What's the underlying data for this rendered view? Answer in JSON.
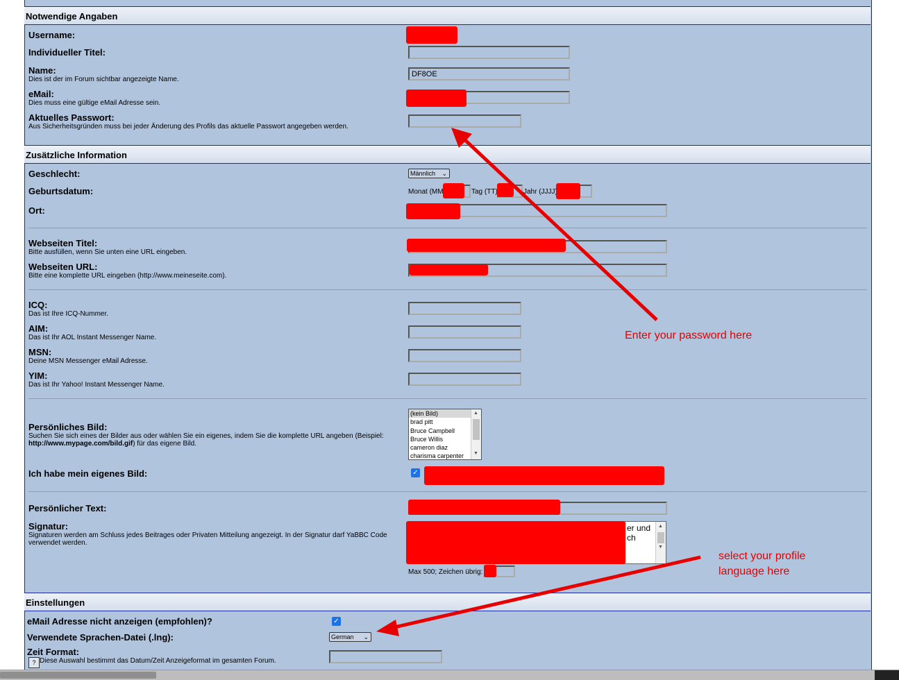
{
  "sections": {
    "required": "Notwendige Angaben",
    "additional": "Zusätzliche Information",
    "settings": "Einstellungen"
  },
  "required": {
    "username_label": "Username:",
    "custom_title_label": "Individueller Titel:",
    "name_label": "Name:",
    "name_desc": "Dies ist der im Forum sichtbar angezeigte Name.",
    "name_value": "DF8OE",
    "email_label": "eMail:",
    "email_desc": "Dies muss eine gültige eMail Adresse sein.",
    "password_label": "Aktuelles Passwort:",
    "password_desc": "Aus Sicherheitsgründen muss bei jeder Änderung des Profils das aktuelle Passwort angegeben werden."
  },
  "additional": {
    "gender_label": "Geschlecht:",
    "gender_value": "Männlich",
    "birthdate_label": "Geburtsdatum:",
    "month_label": "Monat (MM",
    "day_label": "Tag (TT)",
    "year_label": "Jahr (JJJJ)",
    "location_label": "Ort:",
    "website_title_label": "Webseiten Titel:",
    "website_title_desc": "Bitte ausfüllen, wenn Sie unten eine URL eingeben.",
    "website_url_label": "Webseiten URL:",
    "website_url_desc": "Bitte eine komplette URL eingeben (http://www.meineseite.com).",
    "icq_label": "ICQ:",
    "icq_desc": "Das ist Ihre ICQ-Nummer.",
    "aim_label": "AIM:",
    "aim_desc": "Das ist Ihr AOL Instant Messenger Name.",
    "msn_label": "MSN:",
    "msn_desc": "Deine MSN Messenger eMail Adresse.",
    "yim_label": "YIM:",
    "yim_desc": "Das ist Ihr Yahoo! Instant Messenger Name.",
    "avatar_label": "Persönliches Bild:",
    "avatar_desc_1": "Suchen Sie sich eines der Bilder aus oder wählen Sie ein eigenes, indem Sie die komplette URL angeben (Beispiel:",
    "avatar_desc_2": "http://www.mypage.com/bild.gif",
    "avatar_desc_3": ") für das eigene Bild.",
    "avatar_options": [
      "(kein Bild)",
      "brad pitt",
      "Bruce Campbell",
      "Bruce Willis",
      "cameron diaz",
      "charisma carpenter"
    ],
    "own_avatar_label": "Ich habe mein eigenes Bild:",
    "personal_text_label": "Persönlicher Text:",
    "signature_label": "Signatur:",
    "signature_desc_1": "Signaturen werden am Schluss jedes Beitrages oder Privaten Mitteilung angezeigt. In der Signatur darf YaBBC Code",
    "signature_desc_2": "verwendet werden.",
    "signature_fragment_1": "er und",
    "signature_fragment_2": "ch",
    "max_chars_label": "Max 500; Zeichen übrig:"
  },
  "settings": {
    "hide_email_label": "eMail Adresse nicht anzeigen (empfohlen)?",
    "language_label": "Verwendete Sprachen-Datei (.lng):",
    "language_value": "German",
    "time_format_label": "Zeit Format:",
    "time_format_desc": "Diese Auswahl bestimmt das Datum/Zeit Anzeigeformat im gesamten Forum."
  },
  "annotations": {
    "password_hint": "Enter your password here",
    "language_hint_1": "select your profile",
    "language_hint_2": "language here"
  },
  "icons": [
    "chevron-down-icon",
    "checkbox-checked-icon",
    "help-icon"
  ],
  "colors": {
    "panel": "#b0c4de",
    "border": "#1a2aa0",
    "annotation": "#e60000",
    "redaction": "#ff0000"
  }
}
